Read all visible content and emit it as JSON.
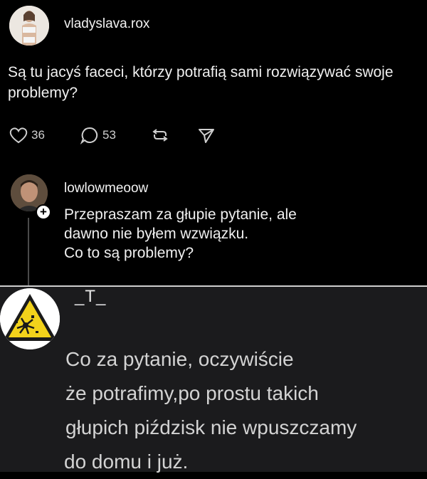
{
  "post1": {
    "username": "vladyslava.rox",
    "text": "Są tu jacyś faceci, którzy potrafią sami rozwiązywać swoje problemy?",
    "likes": "36",
    "comments": "53"
  },
  "post2": {
    "username": "lowlowmeoow",
    "lines": [
      "Przepraszam za głupie pytanie, ale",
      "dawno nie byłem wzwiązku.",
      "Co to są problemy?"
    ]
  },
  "post3": {
    "username": "_T_",
    "lines": [
      "Co za pytanie, oczywiście",
      "że potrafimy,po prostu takich",
      "głupich piździsk nie wpuszczamy",
      "do domu i już."
    ]
  },
  "colors": {
    "background": "#000000",
    "comment_background": "#1b1b1d",
    "warning_yellow": "#f2d21b"
  }
}
